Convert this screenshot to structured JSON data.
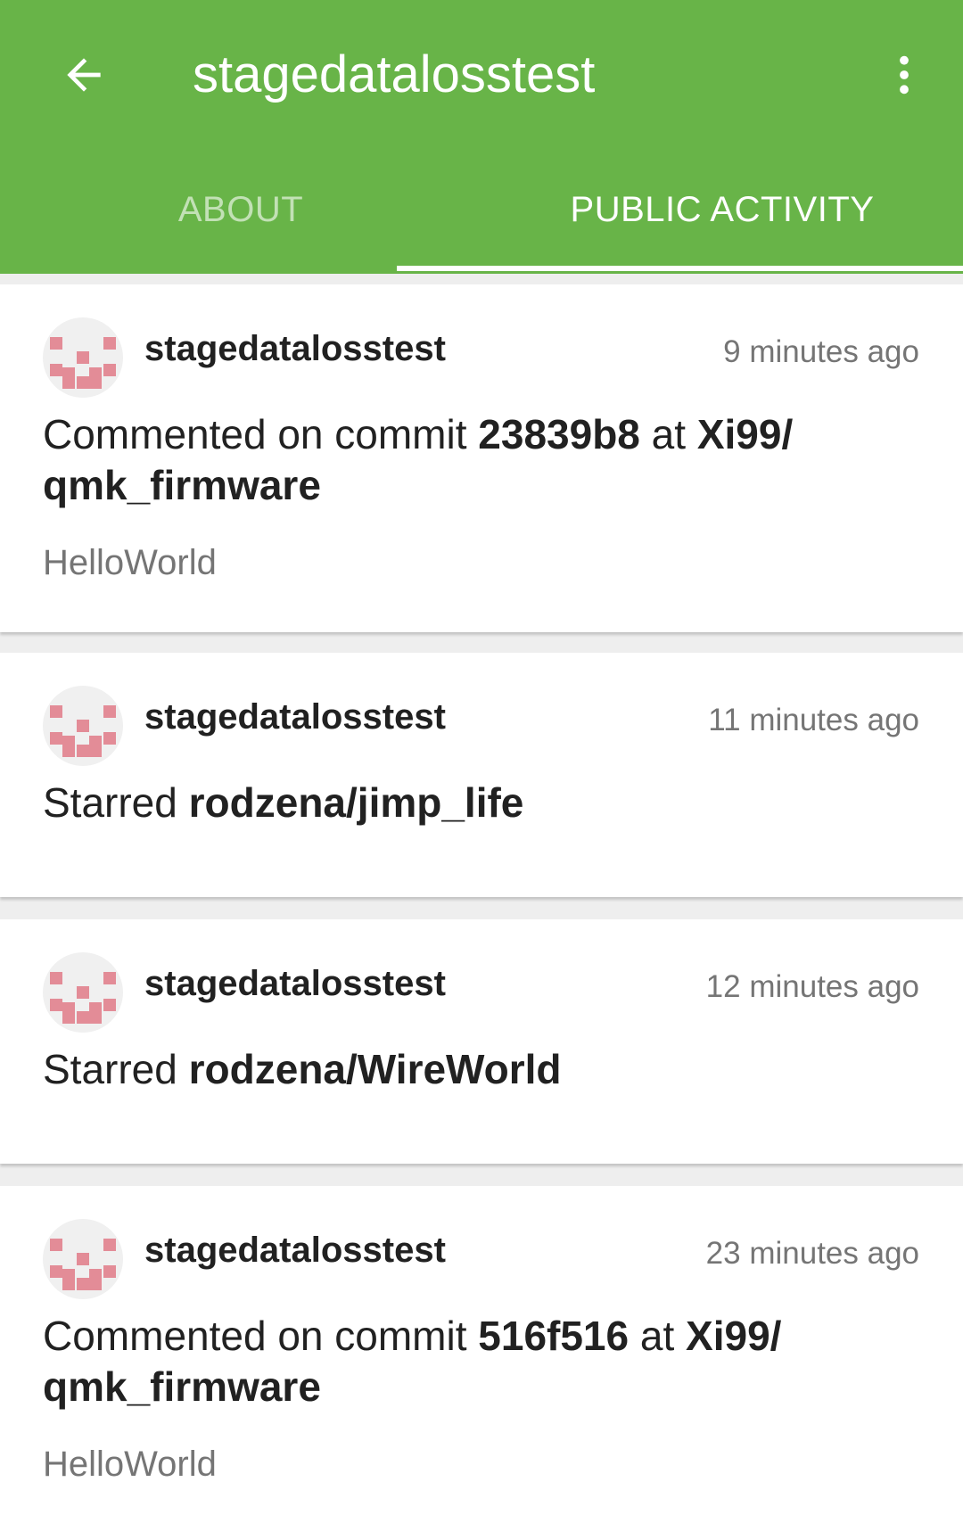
{
  "appbar": {
    "title": "stagedatalosstest",
    "back_icon": "arrow-back-icon",
    "menu_icon": "more-vert-icon",
    "color": "#68b448"
  },
  "tabs": [
    {
      "label": "ABOUT",
      "active": false
    },
    {
      "label": "PUBLIC ACTIVITY",
      "active": true
    }
  ],
  "feed": [
    {
      "user": "stagedatalosstest",
      "time": "9 minutes ago",
      "action": "Commented on commit ",
      "commit": "23839b8",
      "connector": " at ",
      "repo": "Xi99/ qmk_firmware",
      "body": "HelloWorld"
    },
    {
      "user": "stagedatalosstest",
      "time": "11 minutes ago",
      "action": "Starred ",
      "repo": "rodzena/jimp_life"
    },
    {
      "user": "stagedatalosstest",
      "time": "12 minutes ago",
      "action": "Starred ",
      "repo": "rodzena/WireWorld"
    },
    {
      "user": "stagedatalosstest",
      "time": "23 minutes ago",
      "action": "Commented on commit ",
      "commit": "516f516",
      "connector": " at ",
      "repo": "Xi99/ qmk_firmware",
      "body": "HelloWorld"
    }
  ]
}
